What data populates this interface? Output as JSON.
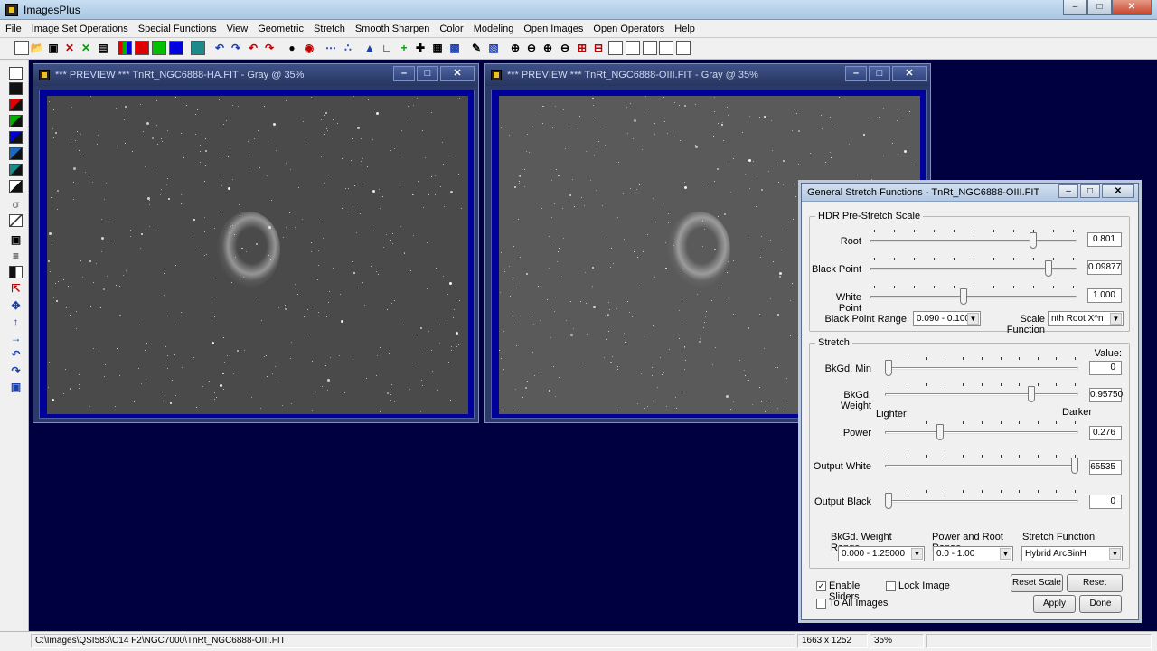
{
  "app": {
    "title": "ImagesPlus",
    "icon": "imagesplus-app-icon"
  },
  "menu": [
    "File",
    "Image Set Operations",
    "Special Functions",
    "View",
    "Geometric",
    "Stretch",
    "Smooth Sharpen",
    "Color",
    "Modeling",
    "Open Images",
    "Open Operators",
    "Help"
  ],
  "windows": [
    {
      "title": "*** PREVIEW *** TnRt_NGC6888-HA.FIT - Gray @ 35%"
    },
    {
      "title": "*** PREVIEW *** TnRt_NGC6888-OIII.FIT - Gray @ 35%"
    }
  ],
  "dialog": {
    "title": "General Stretch Functions - TnRt_NGC6888-OIII.FIT",
    "hdr": {
      "label": "HDR Pre-Stretch Scale",
      "root": {
        "label": "Root",
        "value": "0.801",
        "pos": 0.8
      },
      "black_point": {
        "label": "Black Point",
        "value": "0.09877",
        "pos": 0.876
      },
      "white_point": {
        "label": "White Point",
        "value": "1.000",
        "pos": 0.45
      },
      "black_point_range": {
        "label": "Black Point Range",
        "value": "0.090 - 0.100"
      },
      "scale_function": {
        "label": "Scale Function",
        "value": "nth Root X^n"
      }
    },
    "stretch": {
      "label": "Stretch",
      "value_header": "Value:",
      "bkgd_min": {
        "label": "BkGd. Min",
        "value": "0",
        "pos": 0.0
      },
      "bkgd_weight": {
        "label": "BkGd. Weight",
        "value": "0.95750",
        "pos": 0.766
      },
      "lighter": "Lighter",
      "darker": "Darker",
      "power": {
        "label": "Power",
        "value": "0.276",
        "pos": 0.276
      },
      "output_white": {
        "label": "Output White",
        "value": "65535",
        "pos": 1.0
      },
      "output_black": {
        "label": "Output Black",
        "value": "0",
        "pos": 0.0
      },
      "bkgd_weight_range": {
        "label": "BkGd. Weight Range",
        "value": "0.000 - 1.25000"
      },
      "power_root_range": {
        "label": "Power and Root Range",
        "value": "0.0 - 1.00"
      },
      "stretch_function": {
        "label": "Stretch Function",
        "value": "Hybrid ArcSinH"
      }
    },
    "enable_sliders": {
      "label": "Enable Sliders",
      "checked": true
    },
    "lock_image": {
      "label": "Lock Image",
      "checked": false
    },
    "to_all_images": {
      "label": "To All Images",
      "checked": false
    },
    "buttons": {
      "reset_scale": "Reset Scale",
      "reset_stretch": "Reset Stretch",
      "apply": "Apply",
      "done": "Done"
    }
  },
  "status": {
    "path": "C:\\Images\\QSI583\\C14 F2\\NGC7000\\TnRt_NGC6888-OIII.FIT",
    "dimensions": "1663 x 1252",
    "zoom": "35%"
  }
}
